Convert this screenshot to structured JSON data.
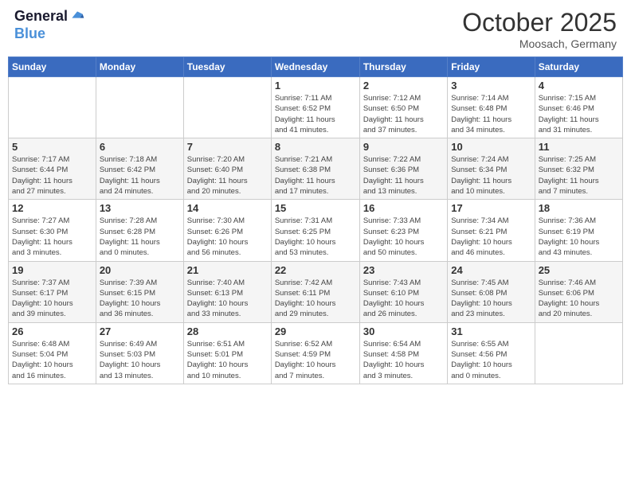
{
  "header": {
    "logo_line1": "General",
    "logo_line2": "Blue",
    "month": "October 2025",
    "location": "Moosach, Germany"
  },
  "weekdays": [
    "Sunday",
    "Monday",
    "Tuesday",
    "Wednesday",
    "Thursday",
    "Friday",
    "Saturday"
  ],
  "weeks": [
    [
      {
        "day": "",
        "info": ""
      },
      {
        "day": "",
        "info": ""
      },
      {
        "day": "",
        "info": ""
      },
      {
        "day": "1",
        "info": "Sunrise: 7:11 AM\nSunset: 6:52 PM\nDaylight: 11 hours\nand 41 minutes."
      },
      {
        "day": "2",
        "info": "Sunrise: 7:12 AM\nSunset: 6:50 PM\nDaylight: 11 hours\nand 37 minutes."
      },
      {
        "day": "3",
        "info": "Sunrise: 7:14 AM\nSunset: 6:48 PM\nDaylight: 11 hours\nand 34 minutes."
      },
      {
        "day": "4",
        "info": "Sunrise: 7:15 AM\nSunset: 6:46 PM\nDaylight: 11 hours\nand 31 minutes."
      }
    ],
    [
      {
        "day": "5",
        "info": "Sunrise: 7:17 AM\nSunset: 6:44 PM\nDaylight: 11 hours\nand 27 minutes."
      },
      {
        "day": "6",
        "info": "Sunrise: 7:18 AM\nSunset: 6:42 PM\nDaylight: 11 hours\nand 24 minutes."
      },
      {
        "day": "7",
        "info": "Sunrise: 7:20 AM\nSunset: 6:40 PM\nDaylight: 11 hours\nand 20 minutes."
      },
      {
        "day": "8",
        "info": "Sunrise: 7:21 AM\nSunset: 6:38 PM\nDaylight: 11 hours\nand 17 minutes."
      },
      {
        "day": "9",
        "info": "Sunrise: 7:22 AM\nSunset: 6:36 PM\nDaylight: 11 hours\nand 13 minutes."
      },
      {
        "day": "10",
        "info": "Sunrise: 7:24 AM\nSunset: 6:34 PM\nDaylight: 11 hours\nand 10 minutes."
      },
      {
        "day": "11",
        "info": "Sunrise: 7:25 AM\nSunset: 6:32 PM\nDaylight: 11 hours\nand 7 minutes."
      }
    ],
    [
      {
        "day": "12",
        "info": "Sunrise: 7:27 AM\nSunset: 6:30 PM\nDaylight: 11 hours\nand 3 minutes."
      },
      {
        "day": "13",
        "info": "Sunrise: 7:28 AM\nSunset: 6:28 PM\nDaylight: 11 hours\nand 0 minutes."
      },
      {
        "day": "14",
        "info": "Sunrise: 7:30 AM\nSunset: 6:26 PM\nDaylight: 10 hours\nand 56 minutes."
      },
      {
        "day": "15",
        "info": "Sunrise: 7:31 AM\nSunset: 6:25 PM\nDaylight: 10 hours\nand 53 minutes."
      },
      {
        "day": "16",
        "info": "Sunrise: 7:33 AM\nSunset: 6:23 PM\nDaylight: 10 hours\nand 50 minutes."
      },
      {
        "day": "17",
        "info": "Sunrise: 7:34 AM\nSunset: 6:21 PM\nDaylight: 10 hours\nand 46 minutes."
      },
      {
        "day": "18",
        "info": "Sunrise: 7:36 AM\nSunset: 6:19 PM\nDaylight: 10 hours\nand 43 minutes."
      }
    ],
    [
      {
        "day": "19",
        "info": "Sunrise: 7:37 AM\nSunset: 6:17 PM\nDaylight: 10 hours\nand 39 minutes."
      },
      {
        "day": "20",
        "info": "Sunrise: 7:39 AM\nSunset: 6:15 PM\nDaylight: 10 hours\nand 36 minutes."
      },
      {
        "day": "21",
        "info": "Sunrise: 7:40 AM\nSunset: 6:13 PM\nDaylight: 10 hours\nand 33 minutes."
      },
      {
        "day": "22",
        "info": "Sunrise: 7:42 AM\nSunset: 6:11 PM\nDaylight: 10 hours\nand 29 minutes."
      },
      {
        "day": "23",
        "info": "Sunrise: 7:43 AM\nSunset: 6:10 PM\nDaylight: 10 hours\nand 26 minutes."
      },
      {
        "day": "24",
        "info": "Sunrise: 7:45 AM\nSunset: 6:08 PM\nDaylight: 10 hours\nand 23 minutes."
      },
      {
        "day": "25",
        "info": "Sunrise: 7:46 AM\nSunset: 6:06 PM\nDaylight: 10 hours\nand 20 minutes."
      }
    ],
    [
      {
        "day": "26",
        "info": "Sunrise: 6:48 AM\nSunset: 5:04 PM\nDaylight: 10 hours\nand 16 minutes."
      },
      {
        "day": "27",
        "info": "Sunrise: 6:49 AM\nSunset: 5:03 PM\nDaylight: 10 hours\nand 13 minutes."
      },
      {
        "day": "28",
        "info": "Sunrise: 6:51 AM\nSunset: 5:01 PM\nDaylight: 10 hours\nand 10 minutes."
      },
      {
        "day": "29",
        "info": "Sunrise: 6:52 AM\nSunset: 4:59 PM\nDaylight: 10 hours\nand 7 minutes."
      },
      {
        "day": "30",
        "info": "Sunrise: 6:54 AM\nSunset: 4:58 PM\nDaylight: 10 hours\nand 3 minutes."
      },
      {
        "day": "31",
        "info": "Sunrise: 6:55 AM\nSunset: 4:56 PM\nDaylight: 10 hours\nand 0 minutes."
      },
      {
        "day": "",
        "info": ""
      }
    ]
  ]
}
